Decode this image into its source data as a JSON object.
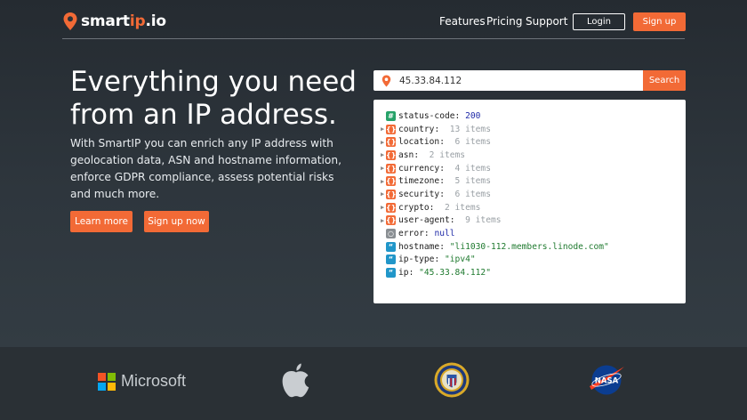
{
  "brand": {
    "logo_main": "smart",
    "logo_accent": "ip",
    "logo_tail": ".io"
  },
  "nav": {
    "features": "Features",
    "pricing": "Pricing",
    "support": "Support",
    "login": "Login",
    "signup": "Sign up"
  },
  "hero": {
    "headline": "Everything you need from an IP address.",
    "subtext": "With SmartIP you can enrich any IP address with geolocation data, ASN and hostname information, enforce GDPR compliance, assess potential risks and much more.",
    "learn_more": "Learn more",
    "sign_up_now": "Sign up now"
  },
  "search": {
    "value": "45.33.84.112",
    "button": "Search"
  },
  "json": {
    "rows": [
      {
        "key": "status-code",
        "type": "number",
        "value": "200",
        "icon": "hash-icon"
      },
      {
        "key": "country",
        "type": "object",
        "count": "13 items",
        "icon": "object-icon"
      },
      {
        "key": "location",
        "type": "object",
        "count": "6 items",
        "icon": "object-icon"
      },
      {
        "key": "asn",
        "type": "object",
        "count": "2 items",
        "icon": "object-icon"
      },
      {
        "key": "currency",
        "type": "object",
        "count": "4 items",
        "icon": "object-icon"
      },
      {
        "key": "timezone",
        "type": "object",
        "count": "5 items",
        "icon": "object-icon"
      },
      {
        "key": "security",
        "type": "object",
        "count": "6 items",
        "icon": "object-icon"
      },
      {
        "key": "crypto",
        "type": "object",
        "count": "2 items",
        "icon": "object-icon"
      },
      {
        "key": "user-agent",
        "type": "object",
        "count": "9 items",
        "icon": "object-icon"
      },
      {
        "key": "error",
        "type": "null",
        "value": "null",
        "icon": "null-icon"
      },
      {
        "key": "hostname",
        "type": "string",
        "value": "\"li1030-112.members.linode.com\"",
        "icon": "string-icon"
      },
      {
        "key": "ip-type",
        "type": "string",
        "value": "\"ipv4\"",
        "icon": "string-icon"
      },
      {
        "key": "ip",
        "type": "string",
        "value": "\"45.33.84.112\"",
        "icon": "string-icon"
      }
    ]
  },
  "logos": {
    "microsoft": "Microsoft",
    "nasa_text": "NASA",
    "items": [
      "microsoft-logo",
      "apple-logo",
      "fbi-seal-logo",
      "nasa-logo"
    ]
  },
  "colors": {
    "accent": "#f26a36",
    "background": "#2b3238",
    "logo_strip": "#2a3035"
  }
}
